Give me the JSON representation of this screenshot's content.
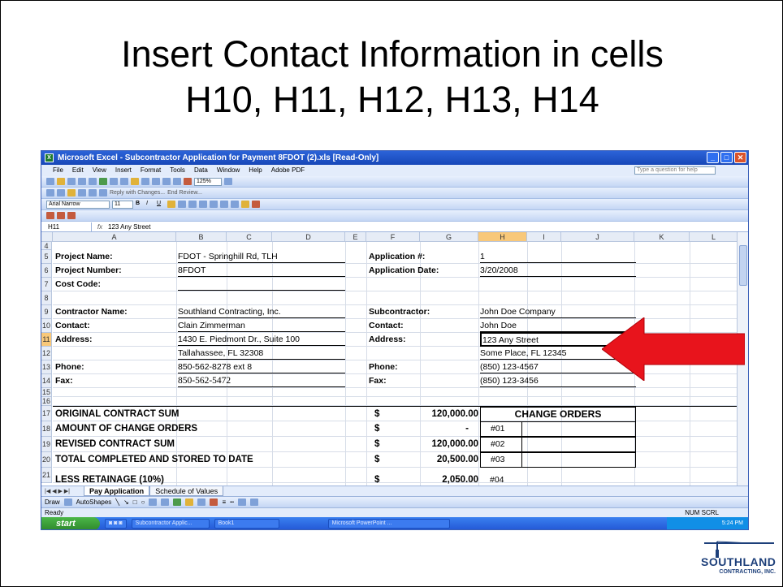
{
  "slide": {
    "title_line1": "Insert Contact Information in cells",
    "title_line2": "H10, H11, H12, H13, H14"
  },
  "excel": {
    "window_title": "Microsoft Excel - Subcontractor Application for Payment 8FDOT (2).xls  [Read-Only]",
    "menu": [
      "File",
      "Edit",
      "View",
      "Insert",
      "Format",
      "Tools",
      "Data",
      "Window",
      "Help",
      "Adobe PDF"
    ],
    "help_placeholder": "Type a question for help",
    "zoom": "125%",
    "reply_changes": "Reply with Changes...",
    "end_review": "End Review...",
    "font_name": "Arial Narrow",
    "font_size": "11",
    "name_box": "H11",
    "fx_symbol": "fx",
    "formula_value": "123 Any Street",
    "columns": [
      "A",
      "B",
      "C",
      "D",
      "E",
      "F",
      "G",
      "H",
      "I",
      "J",
      "K",
      "L"
    ],
    "rows": [
      "4",
      "5",
      "6",
      "7",
      "8",
      "9",
      "10",
      "11",
      "12",
      "13",
      "14",
      "15",
      "16",
      "17",
      "18",
      "19",
      "20",
      "21"
    ],
    "cells": {
      "a5": "Project Name:",
      "b5": "FDOT - Springhill Rd, TLH",
      "f5": "Application #:",
      "h5": "1",
      "a6": "Project Number:",
      "b6": "8FDOT",
      "f6": "Application Date:",
      "h6": "3/20/2008",
      "a7": "Cost Code:",
      "a9": "Contractor Name:",
      "b9": "Southland Contracting, Inc.",
      "f9": "Subcontractor:",
      "h9": "John Doe Company",
      "a10": "Contact:",
      "b10": "Clain Zimmerman",
      "f10": "Contact:",
      "h10": "John Doe",
      "a11": "Address:",
      "b11": "1430 E. Piedmont Dr., Suite 100",
      "f11": "Address:",
      "h11": "123 Any Street",
      "b12": "Tallahassee, FL 32308",
      "h12": "Some Place, FL 12345",
      "a13": "Phone:",
      "b13": "850-562-8278 ext 8",
      "f13": "Phone:",
      "h13": "(850) 123-4567",
      "a14": "Fax:",
      "b14": "850-562-5472",
      "f14": "Fax:",
      "h14": "(850) 123-3456",
      "a17": "ORIGINAL CONTRACT SUM",
      "f17": "$",
      "g17": "120,000.00",
      "h17": "CHANGE ORDERS",
      "a18": "AMOUNT OF CHANGE ORDERS",
      "f18": "$",
      "g18": "-",
      "h18": "#01",
      "a19": "REVISED CONTRACT SUM",
      "f19": "$",
      "g19": "120,000.00",
      "h19": "#02",
      "a20": "TOTAL COMPLETED AND STORED TO DATE",
      "f20": "$",
      "g20": "20,500.00",
      "h20": "#03",
      "a21": "LESS RETAINAGE (10%)",
      "f21": "$",
      "g21": "2,050.00",
      "h21": "#04"
    },
    "sheet_tabs": [
      "Pay Application",
      "Schedule of Values"
    ],
    "draw_label": "Draw",
    "autoshapes_label": "AutoShapes",
    "status_left": "Ready",
    "status_right": "NUM  SCRL"
  },
  "taskbar": {
    "start": "start",
    "tasks": [
      "Subcontractor Applic...",
      "Book1",
      "Microsoft PowerPoint ..."
    ],
    "clock": "5:24 PM"
  },
  "logo": {
    "line1": "SOUTHLAND",
    "line2": "CONTRACTING, INC."
  },
  "colors": {
    "arrow": "#e8141c",
    "selected_header": "#f8c87a",
    "title_bar": "#2c63d8"
  }
}
